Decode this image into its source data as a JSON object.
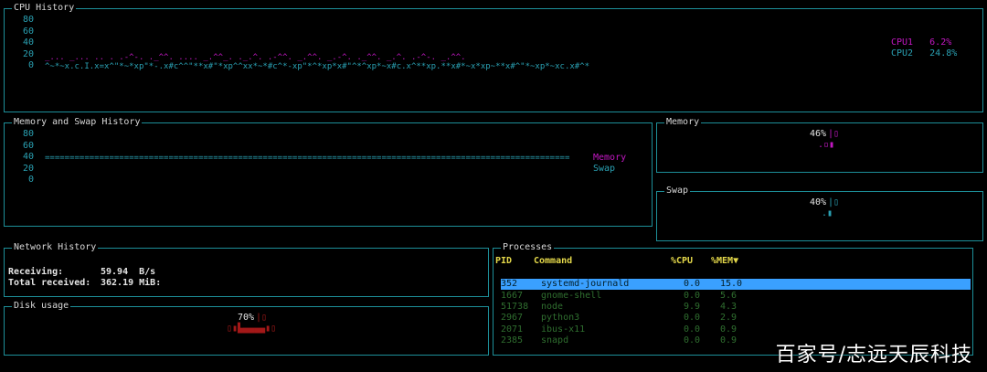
{
  "cpu": {
    "title": "CPU History",
    "axis": [
      "80",
      "60",
      "40",
      "20",
      "0"
    ],
    "legend": [
      {
        "label": "CPU1",
        "value": "6.2%",
        "color": "#c218c2"
      },
      {
        "label": "CPU2",
        "value": "24.8%",
        "color": "#2aa1b3"
      }
    ]
  },
  "memhist": {
    "title": "Memory and Swap History",
    "axis": [
      "80",
      "60",
      "40",
      "20",
      "0"
    ],
    "legend": [
      {
        "label": "Memory",
        "color": "#c218c2"
      },
      {
        "label": "Swap",
        "color": "#2aa1b3"
      }
    ]
  },
  "memory": {
    "title": "Memory",
    "percent": "46%"
  },
  "swap": {
    "title": "Swap",
    "percent": "40%"
  },
  "network": {
    "title": "Network History",
    "receiving_label": "Receiving:",
    "receiving_value": "59.94  B/s",
    "total_label": "Total received:",
    "total_value": "362.19 MiB:"
  },
  "disk": {
    "title": "Disk usage",
    "percent": "70%"
  },
  "processes": {
    "title": "Processes",
    "columns": [
      "PID",
      "Command",
      "%CPU",
      "%MEM▼"
    ],
    "rows": [
      {
        "pid": "352",
        "cmd": "systemd-journald",
        "cpu": "0.0",
        "mem": "15.0",
        "selected": true
      },
      {
        "pid": "1667",
        "cmd": "gnome-shell",
        "cpu": "0.0",
        "mem": "5.6"
      },
      {
        "pid": "51738",
        "cmd": "node",
        "cpu": "9.9",
        "mem": "4.3"
      },
      {
        "pid": "2967",
        "cmd": "python3",
        "cpu": "0.0",
        "mem": "2.9"
      },
      {
        "pid": "2071",
        "cmd": "ibus-x11",
        "cpu": "0.0",
        "mem": "0.9"
      },
      {
        "pid": "2385",
        "cmd": "snapd",
        "cpu": "0.0",
        "mem": "0.9"
      }
    ]
  },
  "watermark": "百家号/志远天辰科技"
}
